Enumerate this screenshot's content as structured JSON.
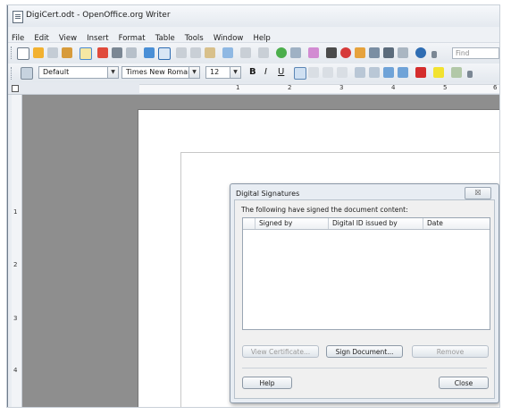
{
  "window": {
    "title": "DigiCert.odt - OpenOffice.org Writer"
  },
  "menu": [
    "File",
    "Edit",
    "View",
    "Insert",
    "Format",
    "Table",
    "Tools",
    "Window",
    "Help"
  ],
  "toolbar": {
    "find_placeholder": "Find",
    "paragraph_style": "Default",
    "font_name": "Times New Roman",
    "font_size": "12",
    "bold": "B",
    "italic": "I",
    "underline": "U"
  },
  "ruler": {
    "numbers": [
      "1",
      "2",
      "3",
      "4",
      "5",
      "6"
    ],
    "vertical_numbers": [
      "1",
      "2",
      "3",
      "4"
    ]
  },
  "dialog": {
    "title": "Digital Signatures",
    "close_glyph": "☒",
    "message": "The following have signed the document content:",
    "columns": [
      "Signed by",
      "Digital ID issued by",
      "Date"
    ],
    "buttons": {
      "view_certificate": "View Certificate...",
      "sign_document": "Sign Document...",
      "remove": "Remove",
      "help": "Help",
      "close": "Close"
    }
  }
}
